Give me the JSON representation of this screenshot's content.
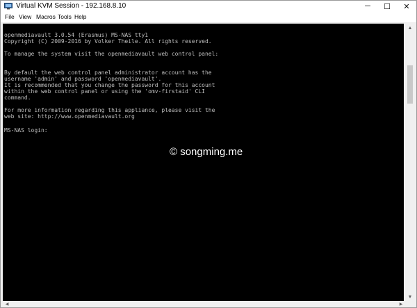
{
  "window": {
    "title": "Virtual KVM Session - 192.168.8.10",
    "controls": {
      "minimize": "─",
      "maximize": "☐",
      "close": "✕"
    }
  },
  "menu": [
    "File",
    "View",
    "Macros",
    "Tools",
    "Help"
  ],
  "terminal": {
    "lines": [
      "openmediavault 3.0.54 (Erasmus) MS-NAS tty1",
      "Copyright (C) 2009-2016 by Volker Theile. All rights reserved.",
      "",
      "To manage the system visit the openmediavault web control panel:",
      "",
      "",
      "",
      "By default the web control panel administrator account has the",
      "username 'admin' and password 'openmediavault'.",
      "It is recommended that you change the password for this account",
      "within the web control panel or using the 'omv-firstaid' CLI",
      "command.",
      "",
      "For more information regarding this appliance, please visit the",
      "web site: http://www.openmediavault.org",
      "",
      "",
      "MS-NAS login:"
    ]
  },
  "watermark": "© songming.me",
  "scrollbar": {
    "up": "▲",
    "down": "▼",
    "left": "◀",
    "right": "▶"
  }
}
